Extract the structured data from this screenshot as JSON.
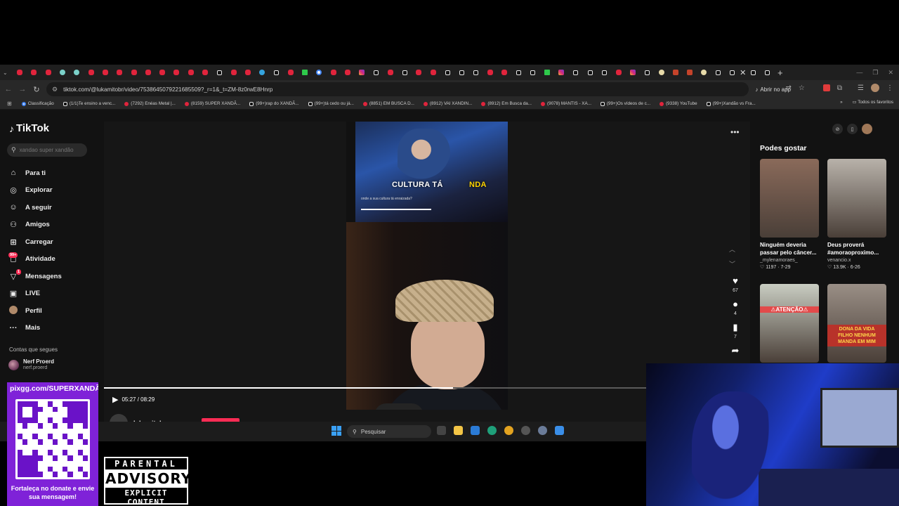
{
  "browser": {
    "tab_favicons": [
      "yt",
      "yt",
      "yt",
      "ch",
      "ch",
      "yt",
      "yt",
      "yt",
      "yt",
      "yt",
      "yt",
      "yt",
      "yt",
      "yt",
      "tt",
      "yt",
      "yt",
      "tg",
      "tt",
      "yt",
      "k",
      "g",
      "yt",
      "yt",
      "ig",
      "tt",
      "yt",
      "tt",
      "yt",
      "yt",
      "tt",
      "tt",
      "tt",
      "yt",
      "yt",
      "tt",
      "tt",
      "k",
      "ig",
      "tt",
      "tt",
      "tt",
      "yt",
      "ig",
      "tt",
      "cr",
      "dz",
      "dz",
      "cr",
      "tt",
      "tt"
    ],
    "url": "tiktok.com/@lukamitobr/video/7538645079221685509?_r=1&_t=ZM-8z0rwE8Hnrp",
    "open_app_label": "Abrir no app",
    "bookmarks": [
      {
        "label": "Classificação",
        "icon": "g"
      },
      {
        "label": "(1/1)Te ensino a venc...",
        "icon": "tt"
      },
      {
        "label": "(7292) Enéas Metal |...",
        "icon": "yt"
      },
      {
        "label": "(8159) SUPER XANDÃ...",
        "icon": "yt"
      },
      {
        "label": "(99+)rap do XANDÃ...",
        "icon": "tt"
      },
      {
        "label": "(99+)tá cedo ou já...",
        "icon": "tt"
      },
      {
        "label": "(8851) EM BUSCA D...",
        "icon": "yt"
      },
      {
        "label": "(8912) VAI XANDIN...",
        "icon": "yt"
      },
      {
        "label": "(8912) Em Busca da...",
        "icon": "yt"
      },
      {
        "label": "(9078) MANTIS - XA...",
        "icon": "yt"
      },
      {
        "label": "(99+)Os vídeos de c...",
        "icon": "tt"
      },
      {
        "label": "(9338) YouTube",
        "icon": "yt"
      },
      {
        "label": "(99+)Xandão vs Fra...",
        "icon": "tt"
      }
    ],
    "all_bookmarks_label": "Todos os favoritos"
  },
  "tiktok": {
    "logo": "TikTok",
    "search_placeholder": "xandao super xandão",
    "nav": [
      {
        "label": "Para ti",
        "icon": "home-icon",
        "glyph": "⌂"
      },
      {
        "label": "Explorar",
        "icon": "compass-icon",
        "glyph": "◎"
      },
      {
        "label": "A seguir",
        "icon": "following-icon",
        "glyph": "☺"
      },
      {
        "label": "Amigos",
        "icon": "friends-icon",
        "glyph": "⚇"
      },
      {
        "label": "Carregar",
        "icon": "upload-icon",
        "glyph": "⊞"
      },
      {
        "label": "Atividade",
        "icon": "activity-icon",
        "glyph": "◻",
        "badge": "99+"
      },
      {
        "label": "Mensagens",
        "icon": "messages-icon",
        "glyph": "▽",
        "badge": "1"
      },
      {
        "label": "LIVE",
        "icon": "live-icon",
        "glyph": "▣"
      },
      {
        "label": "Perfil",
        "icon": "profile-icon",
        "glyph": "●"
      },
      {
        "label": "Mais",
        "icon": "more-icon",
        "glyph": "···"
      }
    ],
    "following_title": "Contas que segues",
    "following_account": {
      "name": "Nerf Proerd",
      "handle": "nerf.proerd"
    },
    "video": {
      "caption_big": "CULTURA TÁ",
      "caption_big_end": "NDA",
      "caption_small": "onde a sua cultura tá enraizada?",
      "time": "05:27 / 08:29",
      "progress": 0.6437,
      "author": "lukamitobr",
      "likes": "67",
      "comments": "4",
      "saves": "7"
    },
    "recommended_title": "Podes gostar",
    "recommended": [
      {
        "title": "Ninguém deveria passar pelo câncer...",
        "user": "_mylenamoraes_",
        "meta": "♡ 1197 · 7-29",
        "bg": "#8a6a5a",
        "overlay": ""
      },
      {
        "title": "Deus proverá #amoraoproximo...",
        "user": "venancio.x",
        "meta": "♡ 13.9K · 6-26",
        "bg": "#b8b2aa",
        "overlay": ""
      },
      {
        "title": "",
        "user": "",
        "meta": "",
        "bg": "#c9cdc2",
        "overlay": "⚠ATENÇÃO⚠"
      },
      {
        "title": "",
        "user": "",
        "meta": "",
        "bg": "#9a8f86",
        "overlay": "DONA DA VIDA FILHO NENHUM MANDA EM MIM"
      }
    ]
  },
  "taskbar": {
    "search_placeholder": "Pesquisar"
  },
  "stream": {
    "pix_url": "pixgg.com/SUPERXANDÃO",
    "donate_message": "Fortaleça no donate e envie sua mensagem!",
    "advisory": {
      "line1": "PARENTAL",
      "line2": "ADVISORY",
      "line3": "EXPLICIT CONTENT"
    }
  },
  "colors": {
    "accent": "#fe2c55",
    "pix": "#7f22d8"
  }
}
